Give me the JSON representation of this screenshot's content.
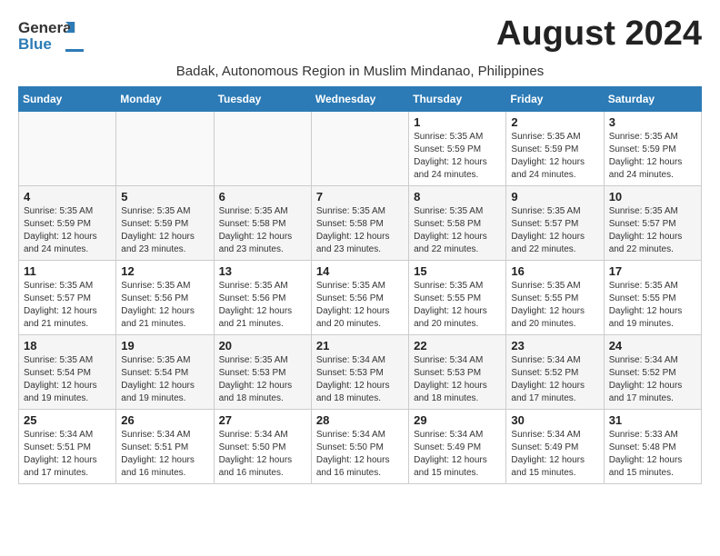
{
  "header": {
    "logo_text1": "General",
    "logo_text2": "Blue",
    "month_title": "August 2024",
    "subtitle": "Badak, Autonomous Region in Muslim Mindanao, Philippines"
  },
  "calendar": {
    "days_of_week": [
      "Sunday",
      "Monday",
      "Tuesday",
      "Wednesday",
      "Thursday",
      "Friday",
      "Saturday"
    ],
    "weeks": [
      [
        {
          "day": "",
          "info": ""
        },
        {
          "day": "",
          "info": ""
        },
        {
          "day": "",
          "info": ""
        },
        {
          "day": "",
          "info": ""
        },
        {
          "day": "1",
          "info": "Sunrise: 5:35 AM\nSunset: 5:59 PM\nDaylight: 12 hours\nand 24 minutes."
        },
        {
          "day": "2",
          "info": "Sunrise: 5:35 AM\nSunset: 5:59 PM\nDaylight: 12 hours\nand 24 minutes."
        },
        {
          "day": "3",
          "info": "Sunrise: 5:35 AM\nSunset: 5:59 PM\nDaylight: 12 hours\nand 24 minutes."
        }
      ],
      [
        {
          "day": "4",
          "info": "Sunrise: 5:35 AM\nSunset: 5:59 PM\nDaylight: 12 hours\nand 24 minutes."
        },
        {
          "day": "5",
          "info": "Sunrise: 5:35 AM\nSunset: 5:59 PM\nDaylight: 12 hours\nand 23 minutes."
        },
        {
          "day": "6",
          "info": "Sunrise: 5:35 AM\nSunset: 5:58 PM\nDaylight: 12 hours\nand 23 minutes."
        },
        {
          "day": "7",
          "info": "Sunrise: 5:35 AM\nSunset: 5:58 PM\nDaylight: 12 hours\nand 23 minutes."
        },
        {
          "day": "8",
          "info": "Sunrise: 5:35 AM\nSunset: 5:58 PM\nDaylight: 12 hours\nand 22 minutes."
        },
        {
          "day": "9",
          "info": "Sunrise: 5:35 AM\nSunset: 5:57 PM\nDaylight: 12 hours\nand 22 minutes."
        },
        {
          "day": "10",
          "info": "Sunrise: 5:35 AM\nSunset: 5:57 PM\nDaylight: 12 hours\nand 22 minutes."
        }
      ],
      [
        {
          "day": "11",
          "info": "Sunrise: 5:35 AM\nSunset: 5:57 PM\nDaylight: 12 hours\nand 21 minutes."
        },
        {
          "day": "12",
          "info": "Sunrise: 5:35 AM\nSunset: 5:56 PM\nDaylight: 12 hours\nand 21 minutes."
        },
        {
          "day": "13",
          "info": "Sunrise: 5:35 AM\nSunset: 5:56 PM\nDaylight: 12 hours\nand 21 minutes."
        },
        {
          "day": "14",
          "info": "Sunrise: 5:35 AM\nSunset: 5:56 PM\nDaylight: 12 hours\nand 20 minutes."
        },
        {
          "day": "15",
          "info": "Sunrise: 5:35 AM\nSunset: 5:55 PM\nDaylight: 12 hours\nand 20 minutes."
        },
        {
          "day": "16",
          "info": "Sunrise: 5:35 AM\nSunset: 5:55 PM\nDaylight: 12 hours\nand 20 minutes."
        },
        {
          "day": "17",
          "info": "Sunrise: 5:35 AM\nSunset: 5:55 PM\nDaylight: 12 hours\nand 19 minutes."
        }
      ],
      [
        {
          "day": "18",
          "info": "Sunrise: 5:35 AM\nSunset: 5:54 PM\nDaylight: 12 hours\nand 19 minutes."
        },
        {
          "day": "19",
          "info": "Sunrise: 5:35 AM\nSunset: 5:54 PM\nDaylight: 12 hours\nand 19 minutes."
        },
        {
          "day": "20",
          "info": "Sunrise: 5:35 AM\nSunset: 5:53 PM\nDaylight: 12 hours\nand 18 minutes."
        },
        {
          "day": "21",
          "info": "Sunrise: 5:34 AM\nSunset: 5:53 PM\nDaylight: 12 hours\nand 18 minutes."
        },
        {
          "day": "22",
          "info": "Sunrise: 5:34 AM\nSunset: 5:53 PM\nDaylight: 12 hours\nand 18 minutes."
        },
        {
          "day": "23",
          "info": "Sunrise: 5:34 AM\nSunset: 5:52 PM\nDaylight: 12 hours\nand 17 minutes."
        },
        {
          "day": "24",
          "info": "Sunrise: 5:34 AM\nSunset: 5:52 PM\nDaylight: 12 hours\nand 17 minutes."
        }
      ],
      [
        {
          "day": "25",
          "info": "Sunrise: 5:34 AM\nSunset: 5:51 PM\nDaylight: 12 hours\nand 17 minutes."
        },
        {
          "day": "26",
          "info": "Sunrise: 5:34 AM\nSunset: 5:51 PM\nDaylight: 12 hours\nand 16 minutes."
        },
        {
          "day": "27",
          "info": "Sunrise: 5:34 AM\nSunset: 5:50 PM\nDaylight: 12 hours\nand 16 minutes."
        },
        {
          "day": "28",
          "info": "Sunrise: 5:34 AM\nSunset: 5:50 PM\nDaylight: 12 hours\nand 16 minutes."
        },
        {
          "day": "29",
          "info": "Sunrise: 5:34 AM\nSunset: 5:49 PM\nDaylight: 12 hours\nand 15 minutes."
        },
        {
          "day": "30",
          "info": "Sunrise: 5:34 AM\nSunset: 5:49 PM\nDaylight: 12 hours\nand 15 minutes."
        },
        {
          "day": "31",
          "info": "Sunrise: 5:33 AM\nSunset: 5:48 PM\nDaylight: 12 hours\nand 15 minutes."
        }
      ]
    ]
  }
}
